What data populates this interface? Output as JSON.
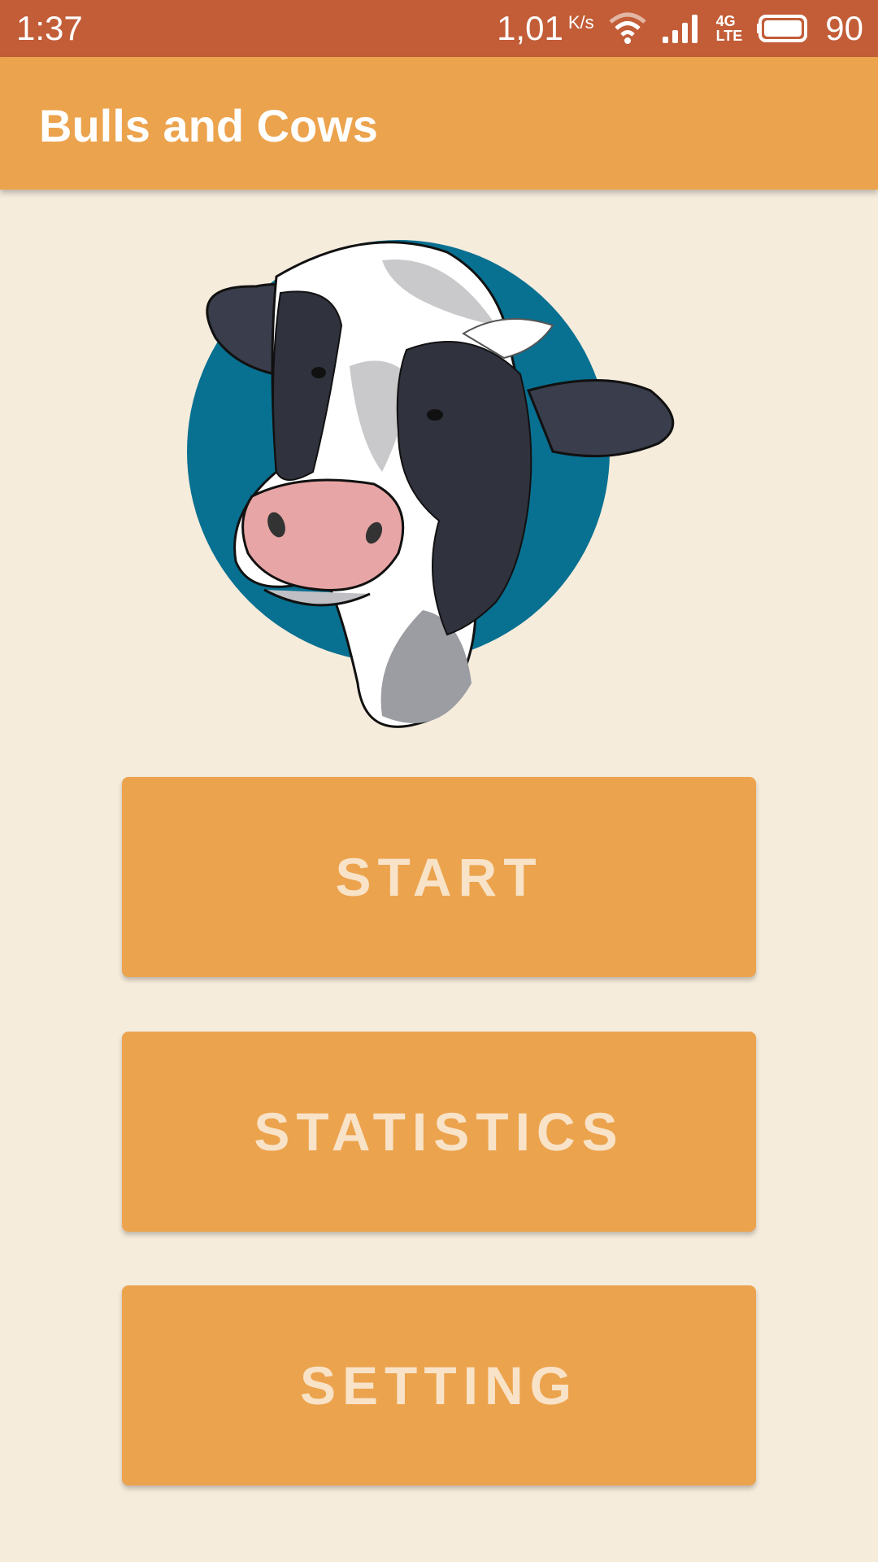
{
  "status_bar": {
    "time": "1:37",
    "net_speed": "1,01",
    "net_unit": "K/s",
    "network_type_top": "4G",
    "network_type_bottom": "LTE",
    "battery": "90"
  },
  "app_bar": {
    "title": "Bulls and Cows"
  },
  "main": {
    "buttons": [
      {
        "label": "START"
      },
      {
        "label": "STATISTICS"
      },
      {
        "label": "SETTING"
      }
    ]
  },
  "icons": {
    "illustration": "cow-head-illustration-icon",
    "wifi": "wifi-icon",
    "signal": "signal-icon",
    "battery": "battery-icon"
  },
  "colors": {
    "status_bar": "#c25d37",
    "app_bar": "#eca34d",
    "background": "#f6ecdc",
    "button": "#eca34d",
    "button_text": "#f8e3c8",
    "circle": "#087091"
  }
}
